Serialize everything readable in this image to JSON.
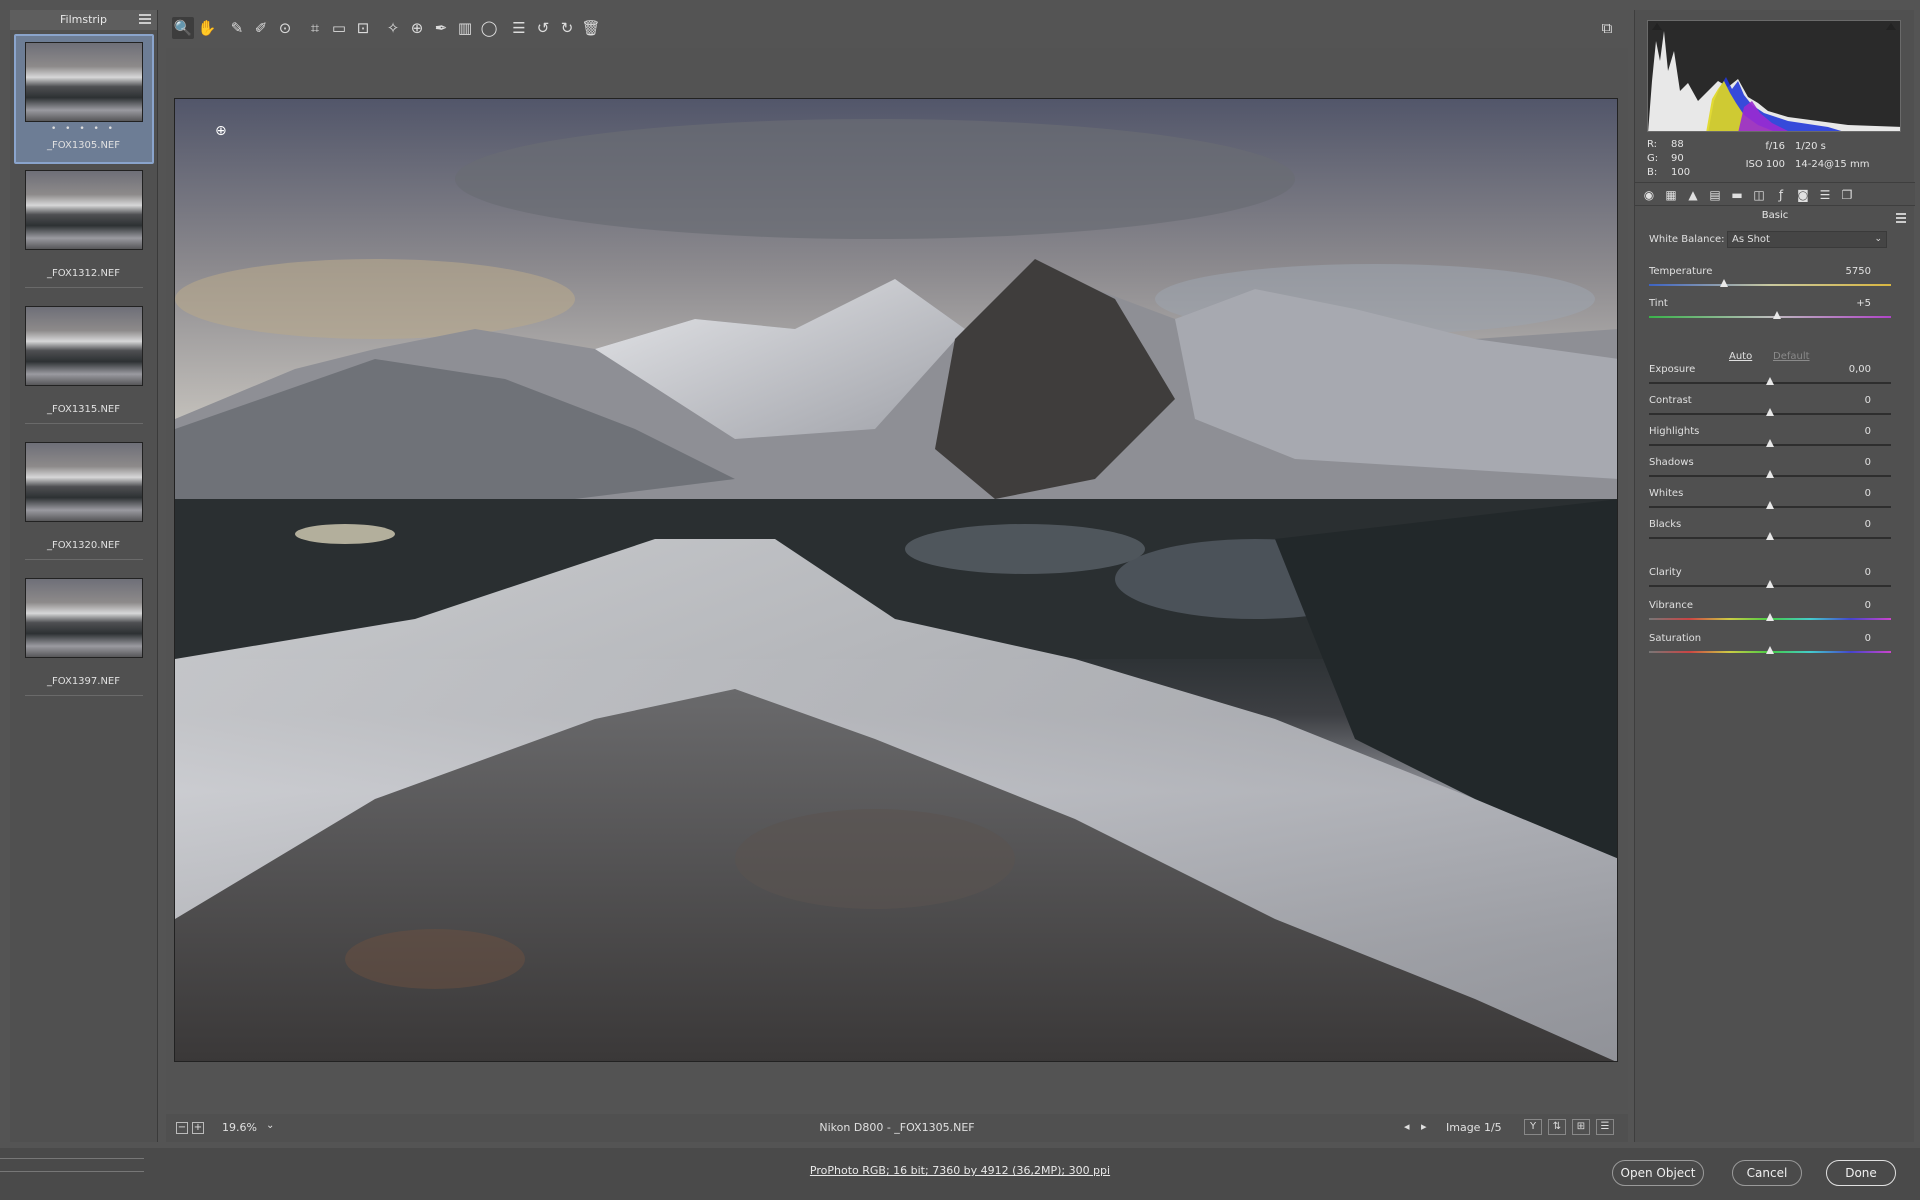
{
  "filmstrip": {
    "title": "Filmstrip",
    "items": [
      {
        "name": "_FOX1305.NEF",
        "rating": "• • • • •",
        "selected": true
      },
      {
        "name": "_FOX1312.NEF",
        "rating": ""
      },
      {
        "name": "_FOX1315.NEF",
        "rating": ""
      },
      {
        "name": "_FOX1320.NEF",
        "rating": ""
      },
      {
        "name": "_FOX1397.NEF",
        "rating": ""
      }
    ]
  },
  "toolbar": {
    "tools": [
      {
        "icon": "zoom-icon",
        "glyph": "🔍"
      },
      {
        "icon": "hand-icon",
        "glyph": "✋"
      },
      {
        "icon": "white-balance-icon",
        "glyph": "✎"
      },
      {
        "icon": "color-sampler-icon",
        "glyph": "✐"
      },
      {
        "icon": "target-adjustment-icon",
        "glyph": "⊙"
      },
      {
        "icon": "crop-icon",
        "glyph": "⌗"
      },
      {
        "icon": "straighten-icon",
        "glyph": "▭"
      },
      {
        "icon": "transform-icon",
        "glyph": "⊡"
      },
      {
        "icon": "spot-removal-icon",
        "glyph": "✧"
      },
      {
        "icon": "red-eye-icon",
        "glyph": "⊕"
      },
      {
        "icon": "adjustment-brush-icon",
        "glyph": "✒"
      },
      {
        "icon": "graduated-filter-icon",
        "glyph": "▥"
      },
      {
        "icon": "radial-filter-icon",
        "glyph": "◯"
      },
      {
        "icon": "preferences-icon",
        "glyph": "☰"
      },
      {
        "icon": "rotate-ccw-icon",
        "glyph": "↺"
      },
      {
        "icon": "rotate-cw-icon",
        "glyph": "↻"
      },
      {
        "icon": "trash-icon",
        "glyph": "🗑"
      }
    ],
    "fullscreen_icon": "⧉"
  },
  "statusbar": {
    "zoom_out": "−",
    "zoom_in": "+",
    "zoom": "19.6%",
    "caret": "⌄",
    "meta": "Nikon D800  -  _FOX1305.NEF",
    "prev": "◂",
    "next": "▸",
    "image_count": "Image 1/5",
    "view_y": "Y"
  },
  "readout": {
    "r_label": "R:",
    "r": "88",
    "g_label": "G:",
    "g": "90",
    "b_label": "B:",
    "b": "100",
    "aperture": "f/16",
    "shutter": "1/20 s",
    "iso": "ISO 100",
    "lens": "14-24@15 mm"
  },
  "panel": {
    "tab_icons": [
      "basic-icon",
      "tone-curve-icon",
      "detail-icon",
      "hsl-icon",
      "split-toning-icon",
      "lens-corrections-icon",
      "effects-icon",
      "camera-calibration-icon",
      "presets-icon",
      "snapshots-icon"
    ],
    "title": "Basic",
    "white_balance_label": "White Balance:",
    "white_balance_value": "As Shot",
    "auto": "Auto",
    "default": "Default",
    "sliders": [
      {
        "label": "Temperature",
        "value": "5750",
        "pos": 0.31,
        "gradient": "linear-gradient(90deg,#3c63c4,#c9c9a0,#d9b640)"
      },
      {
        "label": "Tint",
        "value": "+5",
        "pos": 0.53,
        "gradient": "linear-gradient(90deg,#39b34a,#bdbdbd,#b044c8)"
      },
      {
        "label": "Exposure",
        "value": "0,00",
        "pos": 0.5
      },
      {
        "label": "Contrast",
        "value": "0",
        "pos": 0.5
      },
      {
        "label": "Highlights",
        "value": "0",
        "pos": 0.5
      },
      {
        "label": "Shadows",
        "value": "0",
        "pos": 0.5
      },
      {
        "label": "Whites",
        "value": "0",
        "pos": 0.5
      },
      {
        "label": "Blacks",
        "value": "0",
        "pos": 0.5
      },
      {
        "label": "Clarity",
        "value": "0",
        "pos": 0.5
      },
      {
        "label": "Vibrance",
        "value": "0",
        "pos": 0.5,
        "gradient": "linear-gradient(90deg,#777,#c44,#cc4,#4c4,#4cc,#44c,#c4c)"
      },
      {
        "label": "Saturation",
        "value": "0",
        "pos": 0.5,
        "gradient": "linear-gradient(90deg,#777,#c44,#cc4,#4c4,#4cc,#44c,#c4c)"
      }
    ]
  },
  "bottombar": {
    "workflow_options": "ProPhoto RGB; 16 bit; 7360 by 4912 (36,2MP); 300 ppi",
    "open_object": "Open Object",
    "cancel": "Cancel",
    "done": "Done"
  },
  "colors": {
    "selected_thumb": "#6d7d95",
    "panel_bg": "#505050"
  }
}
